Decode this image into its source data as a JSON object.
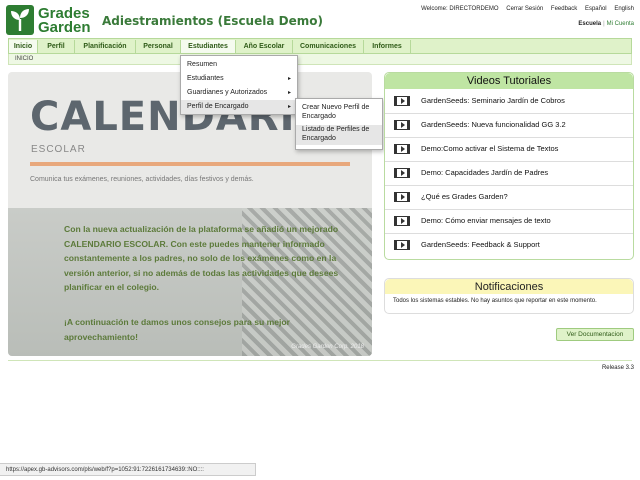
{
  "brand": {
    "line1": "Grades",
    "line2": "Garden"
  },
  "app_title": "Adiestramientos (Escuela Demo)",
  "top_links": {
    "welcome": "Welcome: DIRECTORDEMO",
    "logout": "Cerrar Sesión",
    "feedback": "Feedback",
    "lang_es": "Español",
    "lang_en": "English"
  },
  "school_switch": {
    "current": "Escuela",
    "separator": "|",
    "alt": "Mi Cuenta"
  },
  "nav": [
    {
      "label": "Inicio"
    },
    {
      "label": "Perfil"
    },
    {
      "label": "Planificación"
    },
    {
      "label": "Personal"
    },
    {
      "label": "Estudiantes"
    },
    {
      "label": "Año Escolar"
    },
    {
      "label": "Comunicaciones"
    },
    {
      "label": "Informes"
    }
  ],
  "breadcrumb": "INICIO",
  "students_menu": [
    {
      "label": "Resumen",
      "arrow": ""
    },
    {
      "label": "Estudiantes",
      "arrow": "▸"
    },
    {
      "label": "Guardianes y Autorizados",
      "arrow": "▸"
    },
    {
      "label": "Perfil de Encargado",
      "arrow": "▸"
    }
  ],
  "profile_submenu": [
    {
      "label": "Crear Nuevo Perfil de Encargado"
    },
    {
      "label": "Listado de Perfiles de Encargado"
    }
  ],
  "hero": {
    "title": "CALENDARIO",
    "subtitle": "ESCOLAR",
    "description": "Comunica tus exámenes, reuniones, actividades, días festivos y demás.",
    "paragraph1": "Con la nueva actualización de la plataforma se añadió un mejorado CALENDARIO ESCOLAR. Con este puedes mantener informado constantemente a los padres, no solo de los exámenes como en la versión anterior, si no además de todas las actividades que desees planificar en el colegio.",
    "paragraph2": "¡A continuación te damos unos consejos para su mejor aprovechamiento!",
    "credit": "Grades Garden Corp. 2018"
  },
  "videos": {
    "title": "Videos Tutoriales",
    "items": [
      "GardenSeeds: Seminario Jardín de Cobros",
      "GardenSeeds: Nueva funcionalidad GG 3.2",
      "Demo:Como activar el Sistema de Textos",
      "Demo: Capacidades Jardín de Padres",
      "¿Qué es Grades Garden?",
      "Demo: Cómo enviar mensajes de texto",
      "GardenSeeds: Feedback & Support"
    ]
  },
  "notifications": {
    "title": "Notificaciones",
    "body": "Todos los sistemas estables. No hay asuntos que reportar en este momento."
  },
  "docs_button": "Ver Documentacion",
  "release": "Release 3.3",
  "status_url": "https://apex.gb-advisors.com/pls/web/f?p=1052:91:7226161734639::NO::::"
}
